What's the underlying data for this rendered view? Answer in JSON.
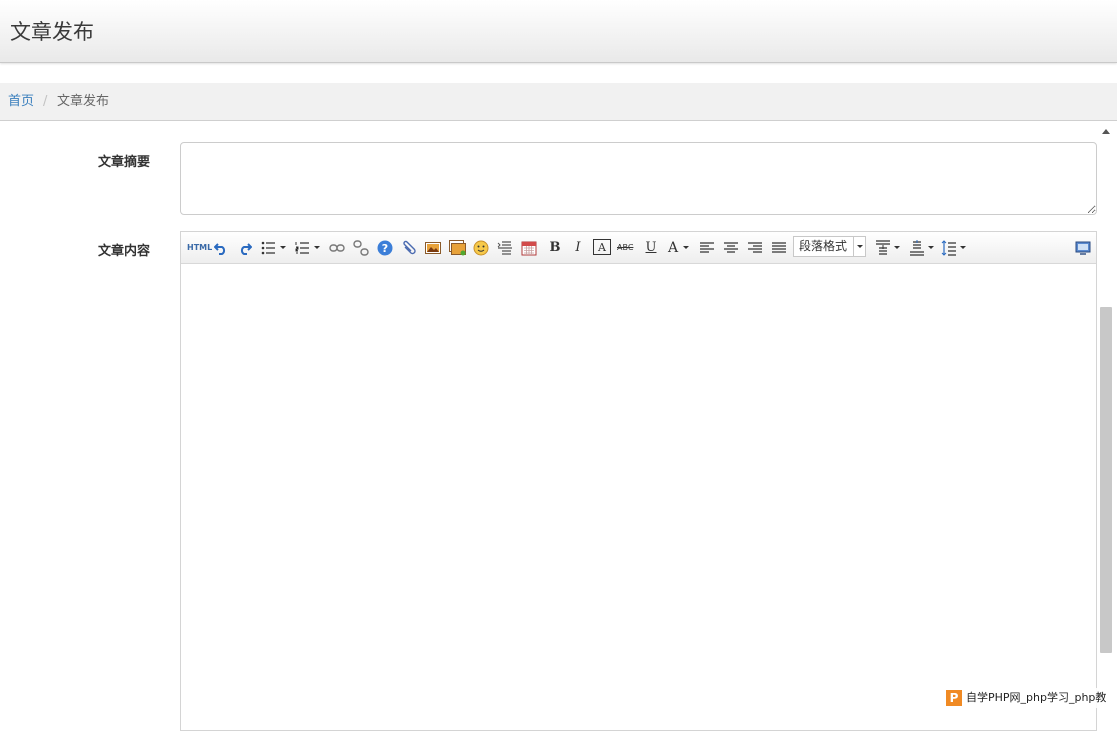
{
  "page": {
    "title": "文章发布"
  },
  "breadcrumb": {
    "home": "首页",
    "separator": "/",
    "current": "文章发布"
  },
  "form": {
    "summary_label": "文章摘要",
    "summary_value": "",
    "content_label": "文章内容",
    "content_value": ""
  },
  "toolbar": {
    "source_label": "HTML",
    "bold": "B",
    "italic": "I",
    "border_char": "A",
    "strike": "ABC",
    "underline": "U",
    "font_color": "A",
    "paragraph_format": "段落格式",
    "icons": [
      "source-html-icon",
      "undo-icon",
      "redo-icon",
      "unordered-list-icon",
      "ordered-list-icon",
      "link-icon",
      "unlink-icon",
      "help-icon",
      "attachment-icon",
      "image-icon",
      "multi-image-icon",
      "emoticon-icon",
      "page-break-icon",
      "date-icon",
      "bold-icon",
      "italic-icon",
      "border-icon",
      "strikethrough-icon",
      "underline-icon",
      "font-color-icon",
      "align-left-icon",
      "align-center-icon",
      "align-right-icon",
      "justify-icon",
      "row-spacing-top-icon",
      "row-spacing-bottom-icon",
      "line-height-icon",
      "fullscreen-icon"
    ]
  },
  "watermark": {
    "text": "自学PHP网_php学习_php教",
    "logo": "P"
  },
  "colors": {
    "link": "#3a7fbd",
    "logo": "#f08a24"
  }
}
